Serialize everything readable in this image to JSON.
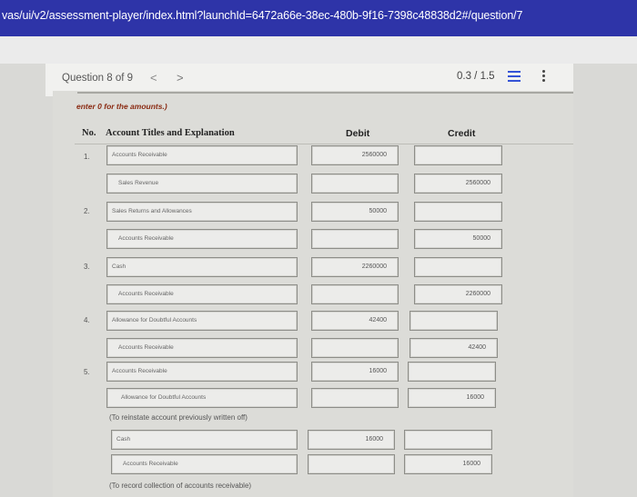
{
  "browser": {
    "url": "vas/ui/v2/assessment-player/index.html?launchId=6472a66e-38ec-480b-9f16-7398c48838d2#/question/7"
  },
  "question_bar": {
    "label": "Question 8 of 9",
    "prev": "<",
    "next": ">",
    "score": "0.3 / 1.5"
  },
  "icons": {
    "list": "list-icon",
    "more": "more-vertical-icon"
  },
  "instruction": "enter 0 for the amounts.)",
  "table": {
    "headers": {
      "no": "No.",
      "account": "Account Titles and Explanation",
      "debit": "Debit",
      "credit": "Credit"
    },
    "entries": [
      {
        "no": "1.",
        "lines": [
          {
            "account": "Accounts Receivable",
            "debit": "2560000",
            "credit": ""
          },
          {
            "account": "Sales Revenue",
            "debit": "",
            "credit": "2560000"
          }
        ]
      },
      {
        "no": "2.",
        "lines": [
          {
            "account": "Sales Returns and Allowances",
            "debit": "50000",
            "credit": ""
          },
          {
            "account": "Accounts Receivable",
            "debit": "",
            "credit": "50000"
          }
        ]
      },
      {
        "no": "3.",
        "lines": [
          {
            "account": "Cash",
            "debit": "2260000",
            "credit": ""
          },
          {
            "account": "Accounts Receivable",
            "debit": "",
            "credit": "2260000"
          }
        ]
      },
      {
        "no": "4.",
        "lines": [
          {
            "account": "Allowance for Doubtful Accounts",
            "debit": "42400",
            "credit": ""
          },
          {
            "account": "Accounts Receivable",
            "debit": "",
            "credit": "42400"
          }
        ]
      },
      {
        "no": "5.",
        "lines": [
          {
            "account": "Accounts Receivable",
            "debit": "16000",
            "credit": ""
          },
          {
            "account": "Allowance for Doubtful Accounts",
            "debit": "",
            "credit": "16000"
          },
          {
            "account": "Cash",
            "debit": "16000",
            "credit": ""
          },
          {
            "account": "Accounts Receivable",
            "debit": "",
            "credit": "16000"
          }
        ]
      }
    ],
    "notes": [
      "(To reinstate account previously written off)",
      "(To record collection of accounts receivable)"
    ]
  }
}
